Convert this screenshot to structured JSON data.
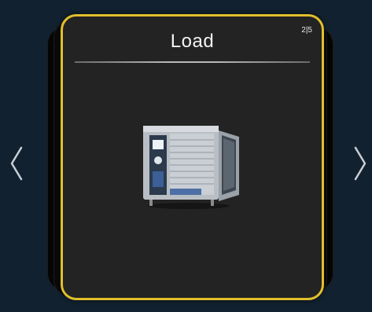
{
  "card": {
    "title": "Load",
    "page_indicator": "2|5"
  },
  "icons": {
    "prev": "chevron-left-icon",
    "next": "chevron-right-icon",
    "illustration": "combi-oven-open-door"
  },
  "colors": {
    "background": "#12212f",
    "card_border": "#e2bf2b",
    "card_fill": "#232323",
    "text": "#f2f2f2"
  }
}
